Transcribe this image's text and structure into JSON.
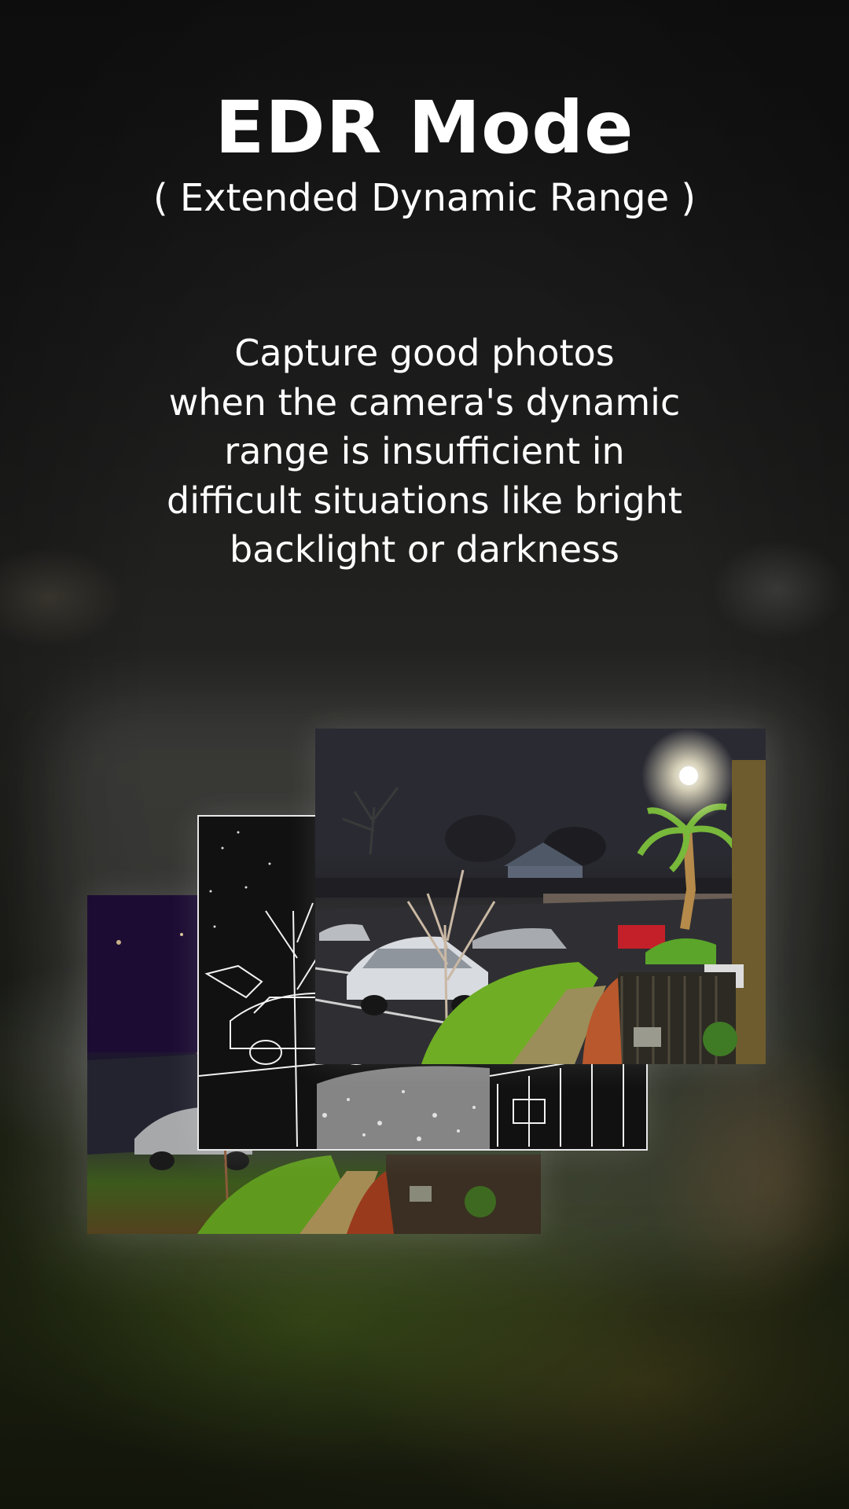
{
  "title": "EDR Mode",
  "subtitle": "( Extended Dynamic Range )",
  "description": {
    "lines": [
      "Capture good photos",
      "when the camera's dynamic",
      "range is insufficient in",
      "difficult situations like bright",
      "backlight or darkness"
    ]
  },
  "colors": {
    "text": "#ffffff",
    "background_top": "#141414",
    "background_bottom": "#1c2010"
  }
}
